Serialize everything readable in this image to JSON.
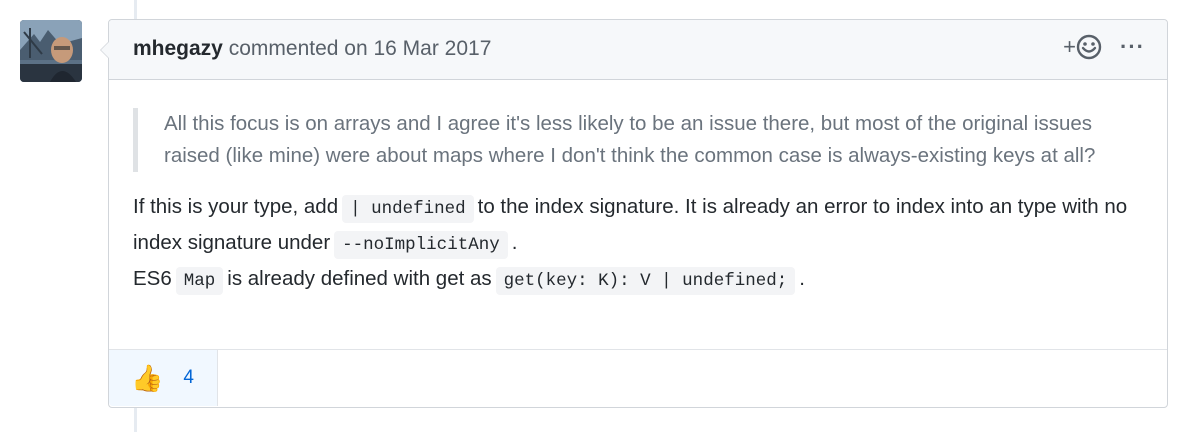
{
  "comment": {
    "author": "mhegazy",
    "action_text": "commented on 16 Mar 2017",
    "quote": "All this focus is on arrays and I agree it's less likely to be an issue there, but most of the original issues raised (like mine) were about maps where I don't think the common case is always-existing keys at all?",
    "body": {
      "line1_before": "If this is your type, add",
      "code1": "| undefined",
      "line1_after": "to the index signature. It is already an error to index into an type with no index signature under",
      "code2": "--noImplicitAny",
      "line2_end": ".",
      "line3_start": "ES6",
      "code3": "Map",
      "line3_mid": "is already defined with get as",
      "code4": "get(key: K): V | undefined;",
      "line3_end": "."
    },
    "reactions": [
      {
        "icon": "thumbs-up-icon",
        "emoji": "👍",
        "count": "4"
      }
    ]
  },
  "header_actions": {
    "add_reaction_plus": "+",
    "more_icon": "···"
  },
  "colors": {
    "header_bg": "#f6f8fa",
    "border": "#d1d5da",
    "reaction_bg": "#f1f8ff",
    "link_blue": "#0366d6"
  }
}
